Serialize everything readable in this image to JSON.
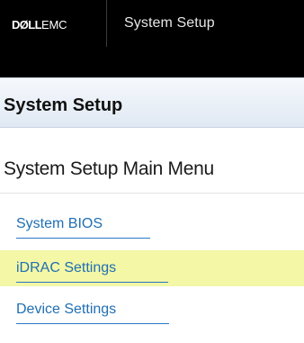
{
  "header": {
    "brand_dell": "DØLL",
    "brand_emc": "EMC",
    "app_title": "System Setup"
  },
  "section": {
    "title": "System Setup"
  },
  "main_menu": {
    "heading": "System Setup Main Menu",
    "items": [
      {
        "label": "System BIOS",
        "selected": false
      },
      {
        "label": "iDRAC Settings",
        "selected": true
      },
      {
        "label": "Device Settings",
        "selected": false
      }
    ]
  },
  "colors": {
    "topbar_bg": "#000000",
    "link": "#1f6fb3",
    "selected_bg": "#f3f7a6"
  }
}
